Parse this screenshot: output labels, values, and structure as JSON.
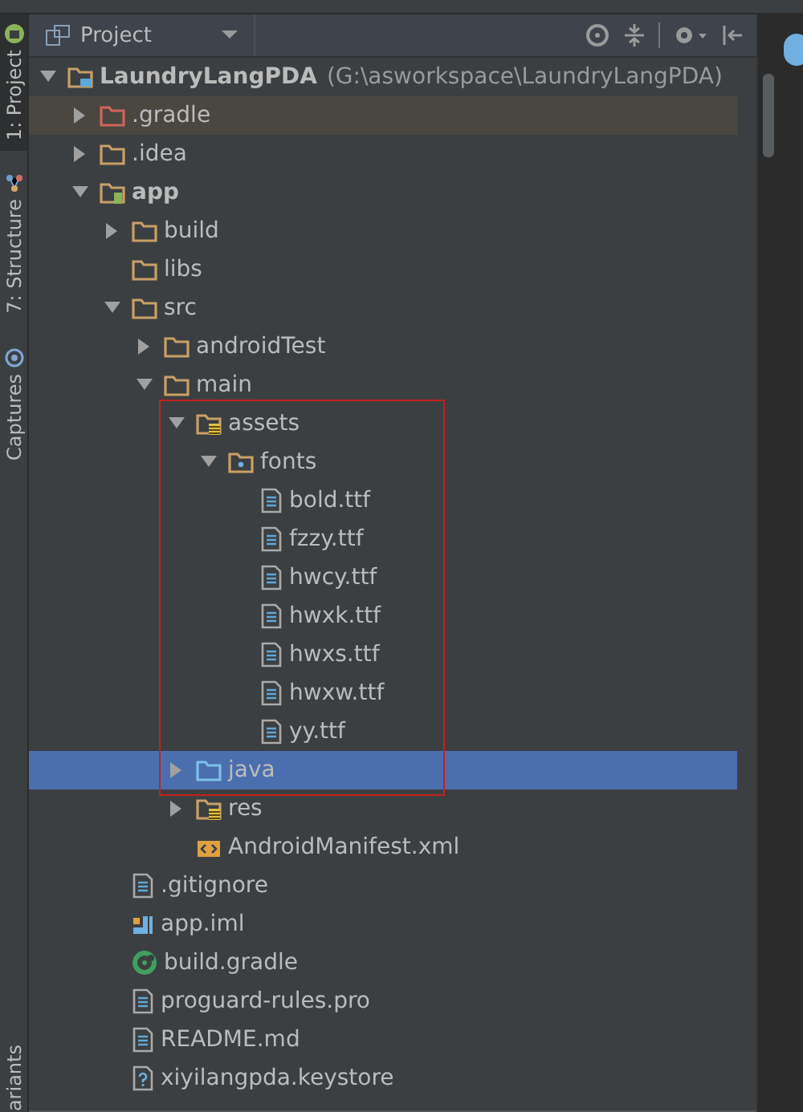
{
  "side_tabs": [
    {
      "label": "1: Project",
      "selected": true
    },
    {
      "label": "7: Structure",
      "selected": false
    },
    {
      "label": "Captures",
      "selected": false
    },
    {
      "label": "ariants",
      "selected": false
    }
  ],
  "panel": {
    "title": "Project"
  },
  "annotation_box": {
    "visible": true
  },
  "tree": [
    {
      "kind": "project",
      "name": "LaundryLangPDA",
      "path": "(G:\\asworkspace\\LaundryLangPDA)",
      "expanded": true,
      "selected": false,
      "hovered": false,
      "children": [
        {
          "kind": "folder-excluded",
          "name": ".gradle",
          "expanded": false,
          "selected": false,
          "hovered": true
        },
        {
          "kind": "folder",
          "name": ".idea",
          "expanded": false,
          "selected": false,
          "hovered": false
        },
        {
          "kind": "module",
          "name": "app",
          "expanded": true,
          "selected": false,
          "hovered": false,
          "children": [
            {
              "kind": "folder",
              "name": "build",
              "expanded": false,
              "selected": false,
              "hovered": false
            },
            {
              "kind": "folder",
              "name": "libs",
              "selected": false,
              "hovered": false
            },
            {
              "kind": "folder",
              "name": "src",
              "expanded": true,
              "selected": false,
              "hovered": false,
              "children": [
                {
                  "kind": "folder",
                  "name": "androidTest",
                  "expanded": false,
                  "selected": false,
                  "hovered": false
                },
                {
                  "kind": "folder",
                  "name": "main",
                  "expanded": true,
                  "selected": false,
                  "hovered": false,
                  "children": [
                    {
                      "kind": "resource-folder",
                      "name": "assets",
                      "expanded": true,
                      "selected": false,
                      "hovered": false,
                      "children": [
                        {
                          "kind": "package-folder",
                          "name": "fonts",
                          "expanded": true,
                          "selected": false,
                          "hovered": false,
                          "children": [
                            {
                              "kind": "text-file",
                              "name": "bold.ttf",
                              "selected": false,
                              "hovered": false
                            },
                            {
                              "kind": "text-file",
                              "name": "fzzy.ttf",
                              "selected": false,
                              "hovered": false
                            },
                            {
                              "kind": "text-file",
                              "name": "hwcy.ttf",
                              "selected": false,
                              "hovered": false
                            },
                            {
                              "kind": "text-file",
                              "name": "hwxk.ttf",
                              "selected": false,
                              "hovered": false
                            },
                            {
                              "kind": "text-file",
                              "name": "hwxs.ttf",
                              "selected": false,
                              "hovered": false
                            },
                            {
                              "kind": "text-file",
                              "name": "hwxw.ttf",
                              "selected": false,
                              "hovered": false
                            },
                            {
                              "kind": "text-file",
                              "name": "yy.ttf",
                              "selected": false,
                              "hovered": false
                            }
                          ]
                        }
                      ]
                    },
                    {
                      "kind": "source-folder",
                      "name": "java",
                      "expanded": false,
                      "selected": true,
                      "hovered": false
                    },
                    {
                      "kind": "resource-folder",
                      "name": "res",
                      "expanded": false,
                      "selected": false,
                      "hovered": false
                    },
                    {
                      "kind": "manifest",
                      "name": "AndroidManifest.xml",
                      "selected": false,
                      "hovered": false
                    }
                  ]
                }
              ]
            },
            {
              "kind": "text-file",
              "name": ".gitignore",
              "selected": false,
              "hovered": false
            },
            {
              "kind": "iml-file",
              "name": "app.iml",
              "selected": false,
              "hovered": false
            },
            {
              "kind": "gradle-file",
              "name": "build.gradle",
              "selected": false,
              "hovered": false
            },
            {
              "kind": "text-file",
              "name": "proguard-rules.pro",
              "selected": false,
              "hovered": false
            },
            {
              "kind": "text-file",
              "name": "README.md",
              "selected": false,
              "hovered": false
            },
            {
              "kind": "unknown-file",
              "name": "xiyilangpda.keystore",
              "selected": false,
              "hovered": false
            }
          ]
        }
      ]
    }
  ]
}
